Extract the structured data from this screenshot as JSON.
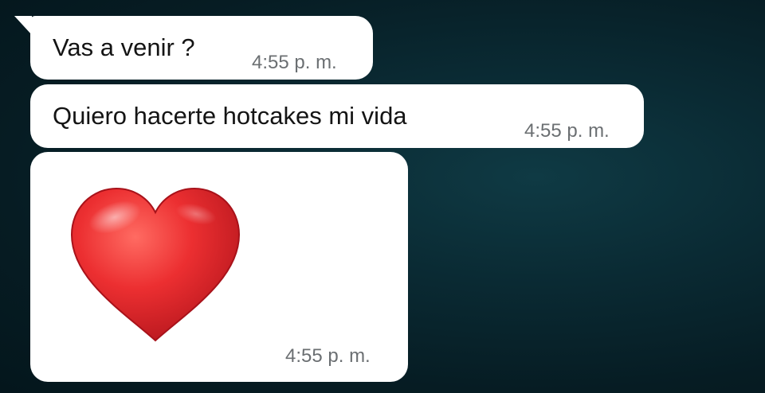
{
  "messages": [
    {
      "text": "Vas a venir ?",
      "time": "4:55 p. m."
    },
    {
      "text": "Quiero hacerte hotcakes mi vida",
      "time": "4:55 p. m."
    },
    {
      "emoji": "red-heart-icon",
      "time": "4:55 p. m."
    }
  ],
  "colors": {
    "bubble": "#ffffff",
    "background": "#0a2a33",
    "timestamp": "#6b6f72",
    "heart": "#e0262c"
  }
}
